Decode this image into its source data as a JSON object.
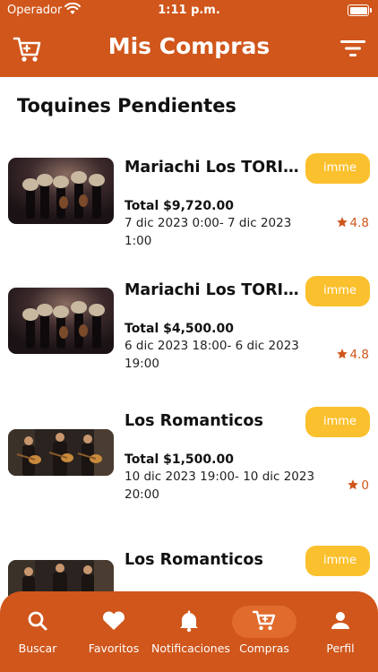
{
  "status": {
    "carrier": "Operador",
    "time": "1:11 p.m."
  },
  "header": {
    "title": "Mis Compras"
  },
  "section": {
    "title": "Toquines Pendientes"
  },
  "orders": [
    {
      "name": "Mariachi Los TORITOS",
      "button_label": "imme",
      "total": "Total $9,720.00",
      "date": "7 dic 2023 0:00- 7 dic 2023 1:00",
      "rating": "4.8"
    },
    {
      "name": "Mariachi Los TORITOS",
      "button_label": "imme",
      "total": "Total $4,500.00",
      "date": "6 dic 2023 18:00- 6 dic 2023 19:00",
      "rating": "4.8"
    },
    {
      "name": "Los Romanticos",
      "button_label": "imme",
      "total": "Total $1,500.00",
      "date": "10 dic 2023 19:00- 10 dic 2023 20:00",
      "rating": "0"
    },
    {
      "name": "Los Romanticos",
      "button_label": "imme"
    }
  ],
  "nav": {
    "items": [
      {
        "label": "Buscar",
        "icon": "search-icon"
      },
      {
        "label": "Favoritos",
        "icon": "heart-icon"
      },
      {
        "label": "Notificaciones",
        "icon": "bell-icon"
      },
      {
        "label": "Compras",
        "icon": "cart-icon",
        "active": true
      },
      {
        "label": "Perfil",
        "icon": "person-icon"
      }
    ]
  },
  "colors": {
    "primary": "#d0561b",
    "accent": "#fbc02d",
    "active_pill": "#e06b2d"
  }
}
